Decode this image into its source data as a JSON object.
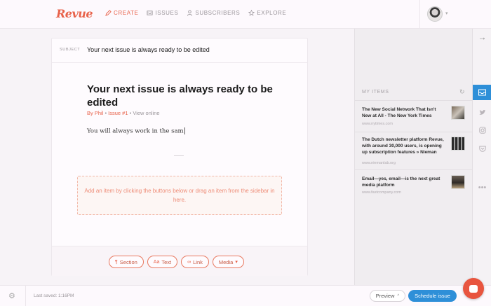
{
  "app": {
    "logo": "Revue"
  },
  "nav": [
    {
      "label": "CREATE",
      "icon": "pen-icon",
      "active": true
    },
    {
      "label": "ISSUES",
      "icon": "inbox-icon",
      "active": false
    },
    {
      "label": "SUBSCRIBERS",
      "icon": "user-icon",
      "active": false
    },
    {
      "label": "EXPLORE",
      "icon": "star-icon",
      "active": false
    }
  ],
  "editor": {
    "subject_label": "SUBJECT",
    "subject_value": "Your next issue is always ready to be edited",
    "title": "Your next issue is always ready to be edited",
    "meta_author": "By Phil",
    "meta_issue": "Issue #1",
    "meta_view": "View online",
    "body": "You will always work in the sam",
    "dropzone": "Add an item by clicking the buttons below or drag an item from the sidebar in here.",
    "tools": [
      {
        "label": "Section",
        "icon": "section-icon"
      },
      {
        "label": "Text",
        "icon": "text-icon"
      },
      {
        "label": "Link",
        "icon": "link-icon"
      },
      {
        "label": "Media",
        "icon": "chevron-down-icon"
      }
    ]
  },
  "sidebar": {
    "header": "MY ITEMS",
    "items": [
      {
        "title": "The New Social Network That Isn't New at All - The New York Times",
        "url": "www.nytimes.com"
      },
      {
        "title": "The Dutch newsletter platform Revue, with around 30,000 users, is opening up subscription features » Nieman",
        "url": "www.niemanlab.org"
      },
      {
        "title": "Email—yes, email—is the next great media platform",
        "url": "www.fastcompany.com"
      }
    ]
  },
  "footer": {
    "saved": "Last saved: 1:16PM",
    "preview": "Preview",
    "schedule": "Schedule issue"
  },
  "colors": {
    "accent": "#e8624a",
    "primary": "#2e8fd8"
  }
}
